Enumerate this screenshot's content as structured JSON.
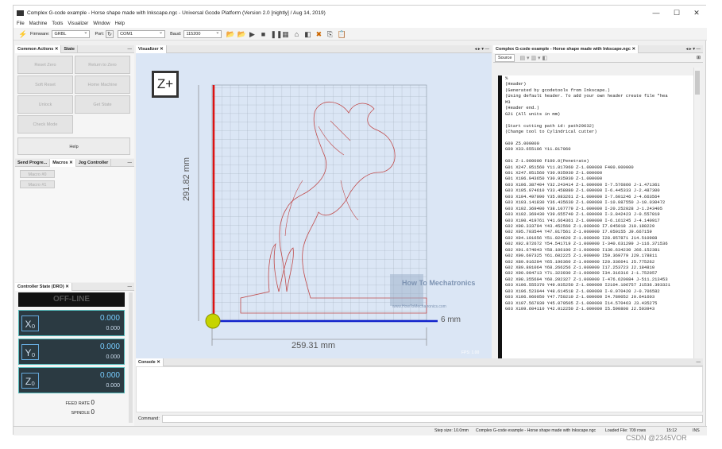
{
  "window": {
    "title": "Complex G-code example - Horse shape made with Inkscape.ngc - Universal Gcode Platform (Version 2.0 [nightly]  / Aug 14, 2019)",
    "minimize": "—",
    "maximize": "☐",
    "close": "✕"
  },
  "menu": [
    "File",
    "Machine",
    "Tools",
    "Visualizer",
    "Window",
    "Help"
  ],
  "toolbar": {
    "firmware_label": "Firmware:",
    "firmware_value": "GRBL",
    "port_label": "Port:",
    "port_value": "COM1",
    "baud_label": "Baud:",
    "baud_value": "115200"
  },
  "left": {
    "tabs_top": [
      "Common Actions",
      "State"
    ],
    "actions": [
      "Reset Zero",
      "Return to Zero",
      "Soft Reset",
      "Home Machine",
      "Unlock",
      "Get State",
      "Check Mode"
    ],
    "help": "Help",
    "tabs_mid": [
      "Send Progre...",
      "Macros",
      "Jog Controller"
    ],
    "macros": [
      "Macro #0",
      "Macro #1"
    ],
    "dro_tab": "Controller State (DRO)",
    "state": "OFF-LINE",
    "axes": [
      {
        "label": "X₀",
        "value": "0.000",
        "sub": "0.000"
      },
      {
        "label": "Y₀",
        "value": "0.000",
        "sub": "0.000"
      },
      {
        "label": "Z₀",
        "value": "0.000",
        "sub": "0.000"
      }
    ],
    "feed_label": "FEED RATE",
    "feed_value": "0",
    "spindle_label": "SPINDLE",
    "spindle_value": "0"
  },
  "visualizer": {
    "tab": "Visualizer",
    "zoom_button": "Z+",
    "height_dim": "291.82 mm",
    "width_dim": "259.31 mm",
    "depth_dim": "6 mm",
    "watermark": "How To Mechatronics",
    "watermark_url": "www.HowToMechatronics.com",
    "fps": "FPS: 1.00"
  },
  "editor": {
    "tab": "Complex G-code example - Horse shape made with Inkscape.ngc",
    "source_tab": "Source",
    "lines": [
      "%",
      "(Header)",
      "(Generated by gcodetools from Inkscape.)",
      "(Using default header. To add your own header create file \"hea",
      "M3",
      "(Header end.)",
      "G21 (All units in mm)",
      "",
      "(Start cutting path id: path29632)",
      "(Change tool to Cylindrical cutter)",
      "",
      "G00 Z5.000000",
      "G00 X33.655106 Y11.817060",
      "",
      "G01 Z-1.000000 F100.0(Penetrate)",
      "G01 X247.951560 Y11.817060 Z-1.000000 F400.000000",
      "G01 X247.951560 Y30.935930 Z-1.000000",
      "G01 X106.943650 Y30.935930 Z-1.000000",
      "G03 X106.387404 Y32.243414 Z-1.000000 I-7.576860 J-1.471361",
      "G03 X105.974610 Y33.458880 Z-1.000000 I-6.445333 J-2.487300",
      "G03 X104.497090 Y35.083261 Z-1.000000 I-7.601246 J-4.663564",
      "G03 X103.141830 Y36.435630 Z-1.000000 I-10.087550 J-10.030472",
      "G03 X102.369400 Y38.107779 Z-1.000000 I-20.252028 J-1.243405",
      "G03 X102.369430 Y39.655740 Z-1.000000 I-3.842423 J-0.557819",
      "G03 X100.419761 Y41.664361 Z-1.000000 I-6.161245 J-4.140917",
      "G02 X98.333794 Y43.452560 Z-1.000000 I7.045018 J10.188229",
      "G02 X95.703544 Y47.017561 Z-1.000000 I7.050155 J9.667159",
      "G02 X94.101656 Y51.024620 Z-1.000000 I28.957871 J14.510988",
      "G02 X92.872672 Y54.541719 Z-1.000000 I-340.631299 J-116.371536",
      "G02 X91.674043 Y58.106100 Z-1.000000 I130.634230 J66.152381",
      "G02 X90.607325 Y61.602225 Z-1.000000 I59.369779 J29.178811",
      "G02 X89.916204 Y65.196360 Z-1.000000 I20.336641 J5.775262",
      "G02 X89.801064 Y68.266256 Z-1.000000 I17.253723 J2.184810",
      "G02 X90.094713 Y71.323930 Z-1.000000 I34.316316 J-1.752057",
      "G02 X98.355694 Y60.202327 Z-1.000000 I-476.620084 J-511.213453",
      "G03 X106.555370 Y49.035250 Z-1.000000 I2104.106757 J1536.393321",
      "G03 X106.523044 Y48.614518 Z-1.000000 I-0.970420 J-0.706582",
      "G03 X106.960050 Y47.750210 Z-1.000000 I4.789052 J0.641603",
      "G03 X107.567039 Y45.070505 Z-1.000000 I14.570463 J3.435275",
      "G03 X109.604110 Y42.012250 Z-1.000000 I5.590808 J2.503943"
    ]
  },
  "console": {
    "tab": "Console",
    "command_label": "Command:"
  },
  "status": {
    "step": "Step size: 10.0mm",
    "file": "Complex G-code example - Horse shape made with Inkscape.ngc",
    "loaded": "Loaded File: 709 rows",
    "pos": "15:12",
    "mode": "INS"
  },
  "watermark_csdn": "CSDN @2345VOR"
}
